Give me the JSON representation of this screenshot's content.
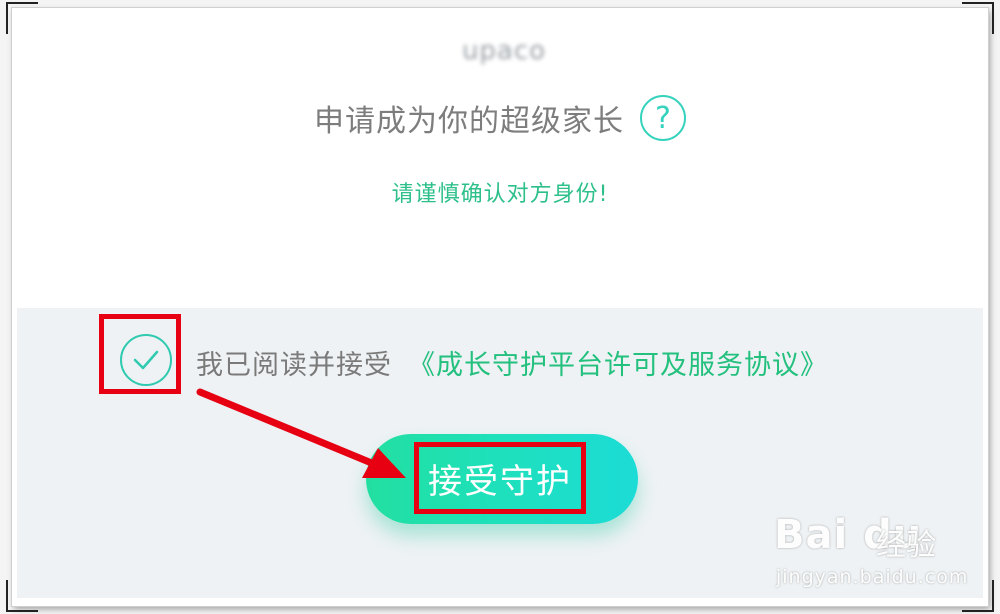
{
  "header": {
    "username": "upaco",
    "title": "申请成为你的超级家长",
    "help_icon": "question-circle-icon",
    "warning": "请谨慎确认对方身份!"
  },
  "agreement": {
    "checked": true,
    "prefix": "我已阅读并接受",
    "link": "《成长守护平台许可及服务协议》"
  },
  "accept_button": {
    "label": "接受守护"
  },
  "watermark": {
    "logo": "Bai du",
    "brand": "经验",
    "url": "jingyan.baidu.com"
  },
  "colors": {
    "accent_green": "#23c07e",
    "teal": "#2fcab0",
    "annotation_red": "#e60012",
    "lower_bg": "#eef2f4"
  }
}
